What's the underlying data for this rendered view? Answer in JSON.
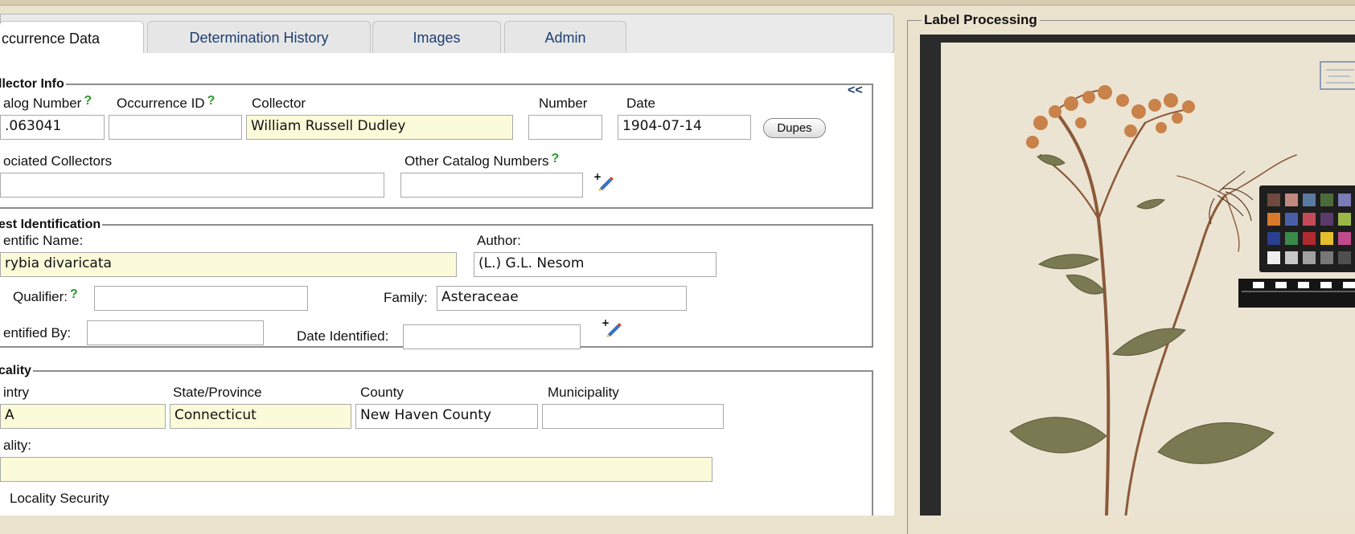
{
  "tabs": [
    {
      "label": "ccurrence Data",
      "active": true
    },
    {
      "label": "Determination History",
      "active": false
    },
    {
      "label": "Images",
      "active": false
    },
    {
      "label": "Admin",
      "active": false
    }
  ],
  "collector_info": {
    "legend": "llector Info",
    "collapse_label": "<<",
    "catalog_number_label": "alog Number",
    "catalog_number_value": ".063041",
    "occurrence_id_label": "Occurrence ID",
    "occurrence_id_value": "",
    "collector_label": "Collector",
    "collector_value": "William Russell Dudley",
    "number_label": "Number",
    "number_value": "",
    "date_label": "Date",
    "date_value": "1904-07-14",
    "dupes_label": "Dupes",
    "assoc_label": "ociated Collectors",
    "assoc_value": "",
    "other_catalog_label": "Other Catalog Numbers",
    "other_catalog_value": "",
    "help_glyph": "?"
  },
  "identification": {
    "legend": "est Identification",
    "sciname_label": "entific Name:",
    "sciname_value": "rybia divaricata",
    "author_label": "Author:",
    "author_value": "(L.) G.L. Nesom",
    "qualifier_label": "Qualifier:",
    "qualifier_value": "",
    "family_label": "Family:",
    "family_value": "Asteraceae",
    "identified_by_label": "entified By:",
    "identified_by_value": "",
    "date_identified_label": "Date Identified:",
    "date_identified_value": ""
  },
  "locality": {
    "legend": "cality",
    "country_label": "intry",
    "country_value": "A",
    "state_label": "State/Province",
    "state_value": "Connecticut",
    "county_label": "County",
    "county_value": "New Haven County",
    "municipality_label": "Municipality",
    "municipality_value": "",
    "locality_label": "ality:",
    "locality_value": "",
    "security_label": "Locality Security"
  },
  "label_processing": {
    "legend": "Label Processing"
  },
  "colors": {
    "background": "#ece3cf",
    "required_field": "#fbfbd9",
    "help_green": "#2a9a2a",
    "tab_text": "#1d3f73"
  }
}
